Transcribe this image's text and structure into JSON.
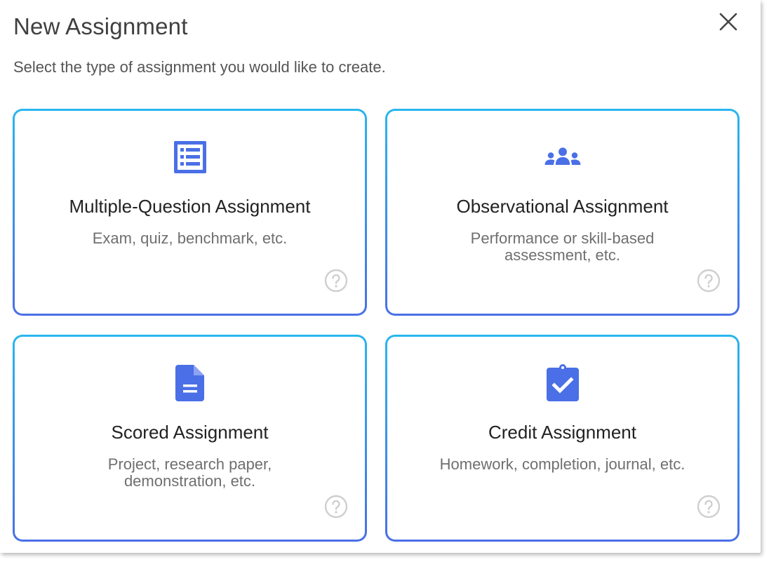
{
  "dialog": {
    "title": "New Assignment",
    "subtitle": "Select the type of assignment you would like to create.",
    "close_icon": "close-icon"
  },
  "colors": {
    "accent": "#4a6fe6",
    "border_top": "#2ab6ee",
    "border_bottom": "#4a6fe6",
    "help_icon": "#cfcfcf"
  },
  "cards": [
    {
      "icon": "list-icon",
      "title": "Multiple-Question Assignment",
      "description": "Exam, quiz, benchmark, etc.",
      "help_icon": "help-circle-icon"
    },
    {
      "icon": "group-icon",
      "title": "Observational Assignment",
      "description": "Performance or skill-based assessment, etc.",
      "help_icon": "help-circle-icon"
    },
    {
      "icon": "document-icon",
      "title": "Scored Assignment",
      "description": "Project, research paper, demonstration, etc.",
      "help_icon": "help-circle-icon"
    },
    {
      "icon": "clipboard-check-icon",
      "title": "Credit Assignment",
      "description": "Homework, completion, journal, etc.",
      "help_icon": "help-circle-icon"
    }
  ]
}
